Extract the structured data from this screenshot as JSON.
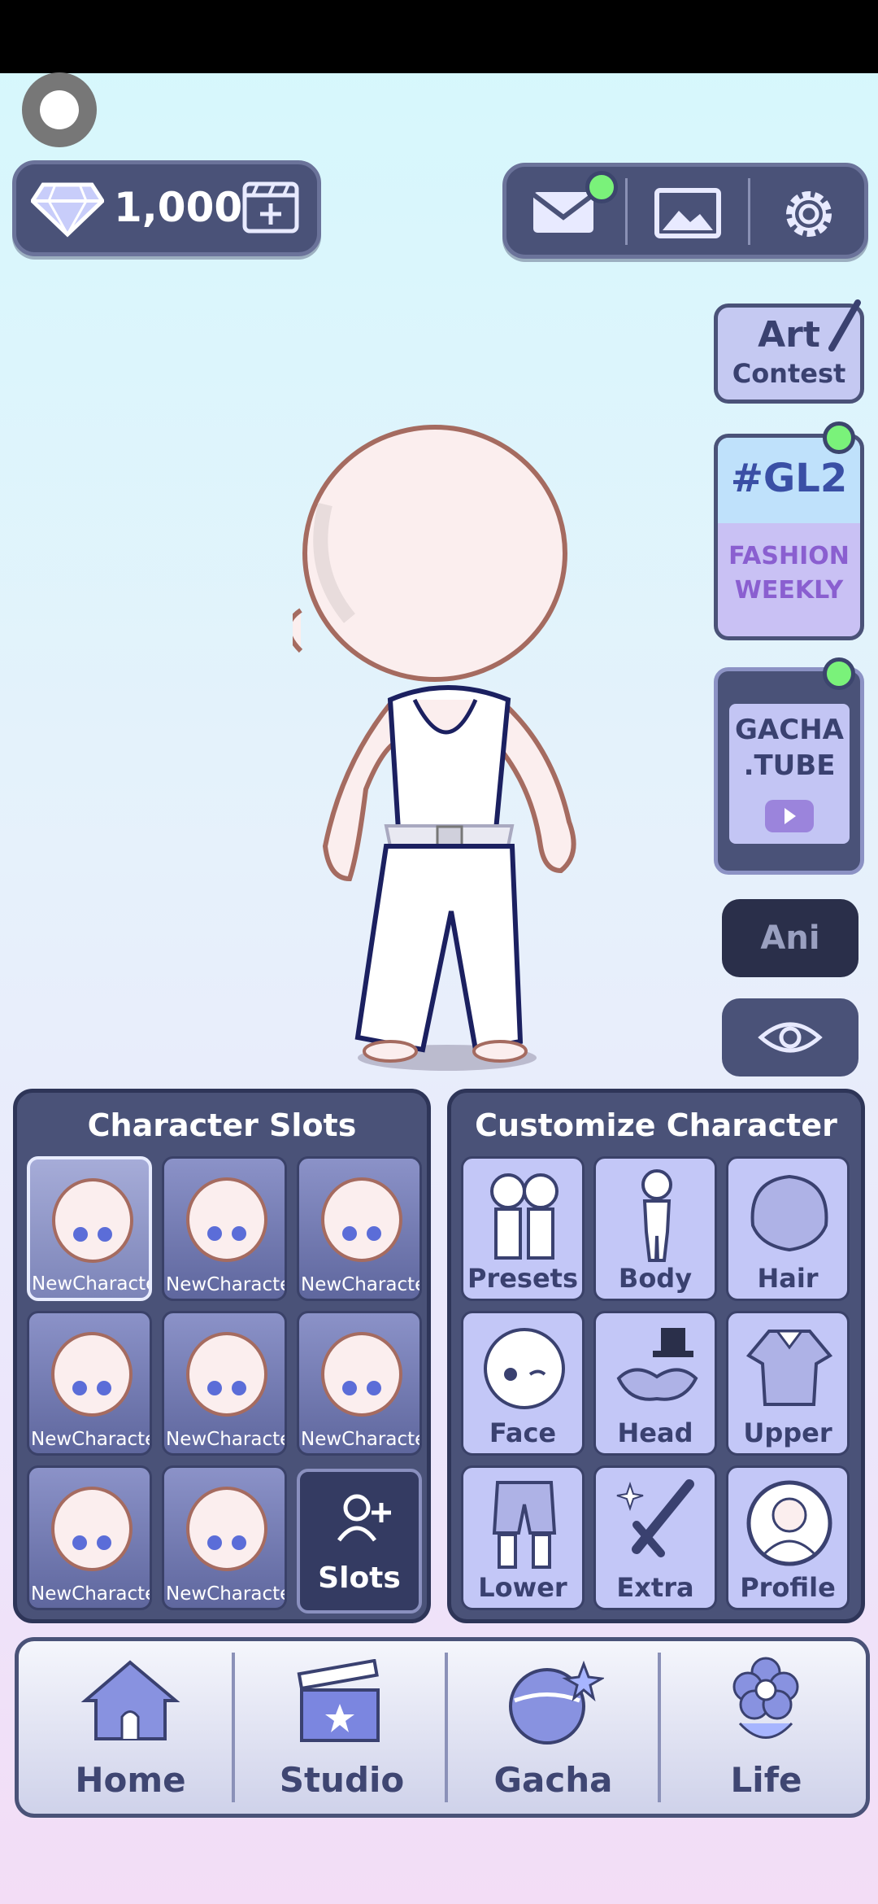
{
  "currency": {
    "gems": "1,000"
  },
  "side": {
    "art_line1": "Art",
    "art_line2": "Contest",
    "gl2_title": "#GL2",
    "gl2_sub1": "FASHION",
    "gl2_sub2": "WEEKLY",
    "tube_line1": "GACHA",
    "tube_line2": ".TUBE",
    "ani": "Ani"
  },
  "slots": {
    "title": "Character Slots",
    "items": [
      "NewCharacter",
      "NewCharacter",
      "NewCharacter",
      "NewCharacter",
      "NewCharacter",
      "NewCharacter",
      "NewCharacter",
      "NewCharacter"
    ],
    "add_label": "Slots"
  },
  "customize": {
    "title": "Customize Character",
    "items": [
      "Presets",
      "Body",
      "Hair",
      "Face",
      "Head",
      "Upper",
      "Lower",
      "Extra",
      "Profile"
    ]
  },
  "nav": {
    "items": [
      "Home",
      "Studio",
      "Gacha",
      "Life"
    ]
  }
}
